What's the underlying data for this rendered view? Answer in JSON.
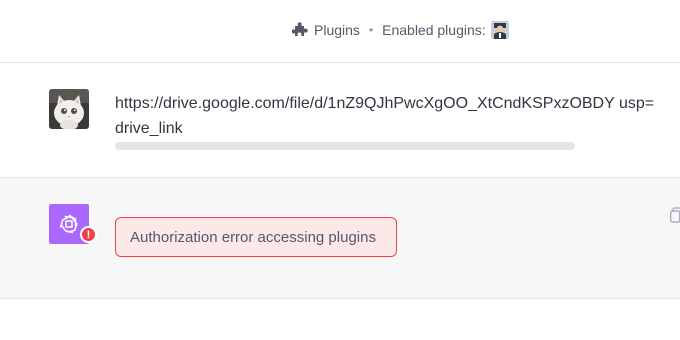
{
  "header": {
    "plugins_label": "Plugins",
    "separator": "•",
    "enabled_label": "Enabled plugins:",
    "icons": [
      "puzzle-icon",
      "plugin-avatar-icon"
    ]
  },
  "messages": {
    "user": {
      "text": "https://drive.google.com/file/d/1nZ9QJhPwcXgOO_XtCndKSPxzOBDY usp=drive_link",
      "avatar": "cat-avatar"
    },
    "assistant": {
      "error_text": "Authorization error accessing plugins",
      "badge_symbol": "!",
      "avatar": "openai-logo-icon"
    }
  },
  "colors": {
    "accent_purple": "#ab68ff",
    "error_red": "#ef4146",
    "error_bg": "#fce8e9",
    "row_alt_bg": "#f7f7f8",
    "loading_bar": "#e3e3e9"
  }
}
